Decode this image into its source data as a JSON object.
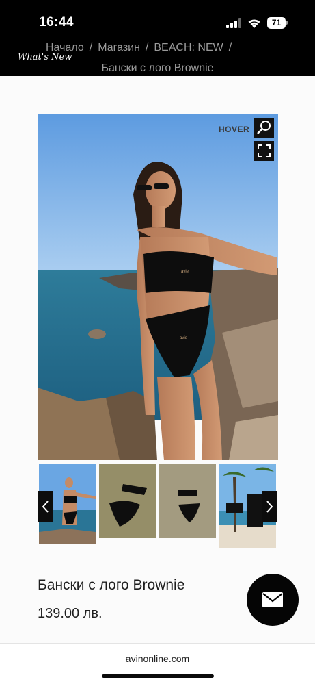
{
  "status_bar": {
    "time": "16:44",
    "battery": "71"
  },
  "header": {
    "brand": "What's New",
    "breadcrumb": [
      "Начало",
      "Магазин",
      "BEACH: NEW"
    ],
    "separator": "/",
    "current": "Бански с лого Brownie"
  },
  "gallery": {
    "hover_label": "HOVER",
    "zoom_icon": "magnifier-icon",
    "fullscreen_icon": "expand-icon",
    "prev_icon": "chevron-left-icon",
    "next_icon": "chevron-right-icon"
  },
  "product": {
    "title": "Бански с лого Brownie",
    "price": "139.00 лв."
  },
  "browser": {
    "url": "avinonline.com"
  },
  "colors": {
    "header_bg": "#000000",
    "accent": "#050505",
    "text": "#1e1e1e"
  }
}
